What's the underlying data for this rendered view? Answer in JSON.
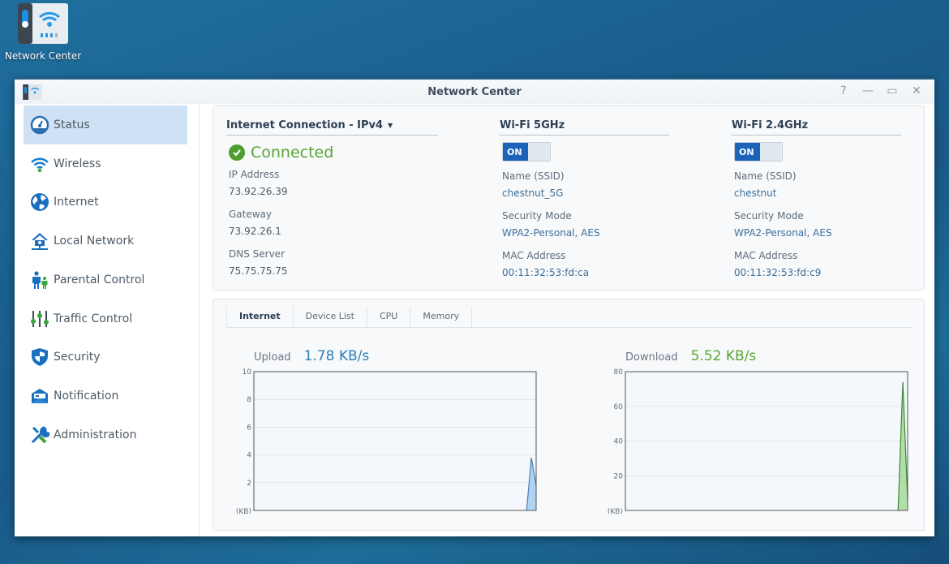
{
  "desktop": {
    "icon_label": "Network Center",
    "icon_name": "network-center-icon"
  },
  "window": {
    "title": "Network Center",
    "controls": {
      "help": "?",
      "minimize": "—",
      "maximize": "▭",
      "close": "✕"
    }
  },
  "sidebar": {
    "items": [
      {
        "label": "Status",
        "icon": "gauge-icon",
        "active": true
      },
      {
        "label": "Wireless",
        "icon": "wifi-icon",
        "active": false
      },
      {
        "label": "Internet",
        "icon": "globe-icon",
        "active": false
      },
      {
        "label": "Local Network",
        "icon": "house-network-icon",
        "active": false
      },
      {
        "label": "Parental Control",
        "icon": "family-icon",
        "active": false
      },
      {
        "label": "Traffic Control",
        "icon": "sliders-icon",
        "active": false
      },
      {
        "label": "Security",
        "icon": "shield-icon",
        "active": false
      },
      {
        "label": "Notification",
        "icon": "envelope-icon",
        "active": false
      },
      {
        "label": "Administration",
        "icon": "tools-icon",
        "active": false
      }
    ]
  },
  "internet": {
    "title": "Internet Connection - IPv4",
    "status": "Connected",
    "fields": [
      {
        "label": "IP Address",
        "value": "73.92.26.39"
      },
      {
        "label": "Gateway",
        "value": "73.92.26.1"
      },
      {
        "label": "DNS Server",
        "value": "75.75.75.75"
      }
    ]
  },
  "wifi5": {
    "title": "Wi-Fi 5GHz",
    "toggle": "ON",
    "fields": [
      {
        "label": "Name (SSID)",
        "value": "chestnut_5G"
      },
      {
        "label": "Security Mode",
        "value": "WPA2-Personal, AES"
      },
      {
        "label": "MAC Address",
        "value": "00:11:32:53:fd:ca"
      }
    ]
  },
  "wifi24": {
    "title": "Wi-Fi 2.4GHz",
    "toggle": "ON",
    "fields": [
      {
        "label": "Name (SSID)",
        "value": "chestnut"
      },
      {
        "label": "Security Mode",
        "value": "WPA2-Personal, AES"
      },
      {
        "label": "MAC Address",
        "value": "00:11:32:53:fd:c9"
      }
    ]
  },
  "tabs": [
    {
      "label": "Internet",
      "active": true
    },
    {
      "label": "Device List",
      "active": false
    },
    {
      "label": "CPU",
      "active": false
    },
    {
      "label": "Memory",
      "active": false
    }
  ],
  "upload": {
    "label": "Upload",
    "value": "1.78 KB/s",
    "color": "#2a7fb8"
  },
  "download": {
    "label": "Download",
    "value": "5.52 KB/s",
    "color": "#5aa532"
  },
  "chart_data": [
    {
      "type": "area",
      "title": "Upload",
      "ylabel": "(KB)",
      "ylim": [
        0,
        10
      ],
      "yticks": [
        2,
        4,
        6,
        8,
        10
      ],
      "grid": true,
      "x_points": 60,
      "series": [
        {
          "name": "Upload",
          "values_tail": [
            0,
            3.8,
            1.8
          ],
          "color": "#9dcbf0",
          "stroke": "#4a7fb0"
        }
      ]
    },
    {
      "type": "area",
      "title": "Download",
      "ylabel": "(KB)",
      "ylim": [
        0,
        80
      ],
      "yticks": [
        20,
        40,
        60,
        80
      ],
      "grid": true,
      "x_points": 60,
      "series": [
        {
          "name": "Download",
          "values_tail": [
            0,
            74,
            5.5
          ],
          "color": "#9fd694",
          "stroke": "#3f8a34"
        }
      ]
    }
  ]
}
